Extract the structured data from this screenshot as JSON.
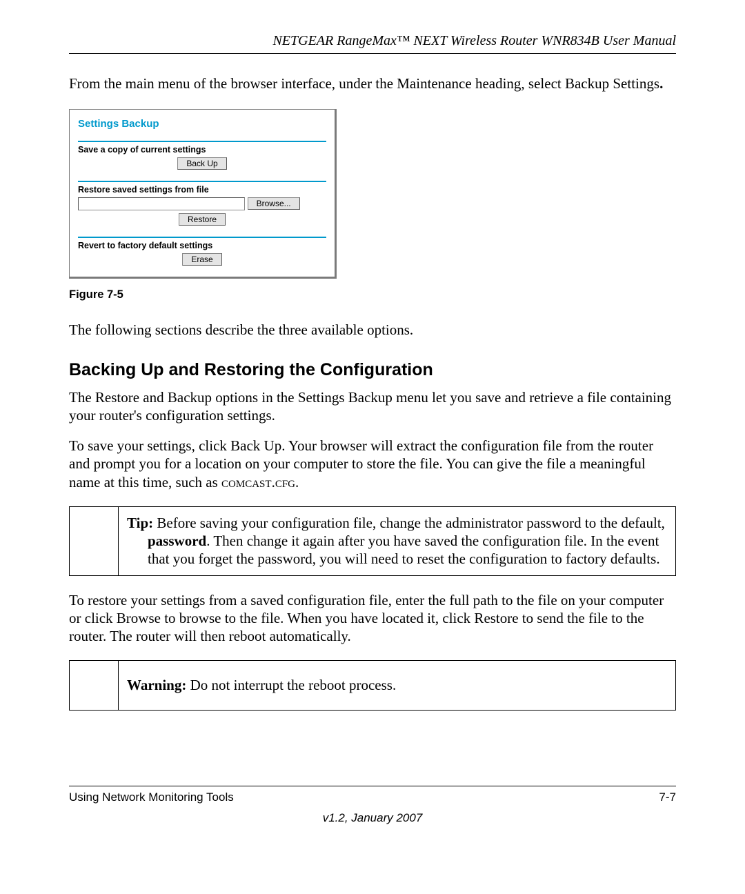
{
  "header": {
    "running_title": "NETGEAR RangeMax™ NEXT Wireless Router WNR834B User Manual"
  },
  "intro_para": "From the main menu of the browser interface, under the Maintenance heading, select Backup Settings",
  "intro_period": ".",
  "screenshot": {
    "title": "Settings Backup",
    "sec1_label": "Save a copy of current settings",
    "backup_btn": "Back Up",
    "sec2_label": "Restore saved settings from file",
    "browse_btn": "Browse...",
    "restore_btn": "Restore",
    "sec3_label": "Revert to factory default settings",
    "erase_btn": "Erase"
  },
  "figure_caption": "Figure 7-5",
  "para_after_fig": "The following sections describe the three available options.",
  "h2": "Backing Up and Restoring the Configuration",
  "para_b1": "The Restore and Backup options in the Settings Backup menu let you save and retrieve a file containing your router's configuration settings.",
  "para_b2_a": "To save your settings, click Back Up. Your browser will extract the configuration file from the router and prompt you for a location on your computer to store the file. You can give the file a meaningful name at this time, such as ",
  "para_b2_sc": "comcast.cfg",
  "para_b2_c": ".",
  "tip": {
    "lead": "Tip:",
    "line1": " Before saving your configuration file, change the administrator password to the default, ",
    "bold": "password",
    "line2": ". Then change it again after you have saved the configuration file. In the event that you forget the password, you will need to reset the configuration to factory defaults."
  },
  "para_b3": "To restore your settings from a saved configuration file, enter the full path to the file on your computer or click Browse to browse to the file. When you have located it, click Restore to send the file to the router. The router will then reboot automatically.",
  "warning": {
    "lead": "Warning:",
    "text": " Do not interrupt the reboot process."
  },
  "footer": {
    "left": "Using Network Monitoring Tools",
    "right": "7-7",
    "version": "v1.2, January 2007"
  }
}
